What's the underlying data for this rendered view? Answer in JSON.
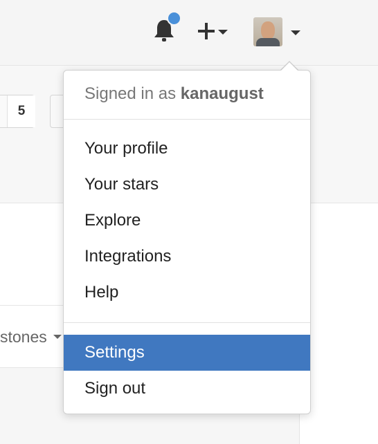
{
  "header": {
    "notification_icon": "bell-icon",
    "notification_dot_color": "#4a90d9",
    "create_icon": "plus-icon",
    "avatar_icon": "avatar"
  },
  "background": {
    "count_value": "5",
    "milestones_label": "stones"
  },
  "user_menu": {
    "signed_in_prefix": "Signed in as ",
    "username": "kanaugust",
    "items": [
      {
        "label": "Your profile"
      },
      {
        "label": "Your stars"
      },
      {
        "label": "Explore"
      },
      {
        "label": "Integrations"
      },
      {
        "label": "Help"
      },
      {
        "label": "Settings",
        "highlighted": true
      },
      {
        "label": "Sign out"
      }
    ],
    "highlight_color": "#4078c0"
  }
}
